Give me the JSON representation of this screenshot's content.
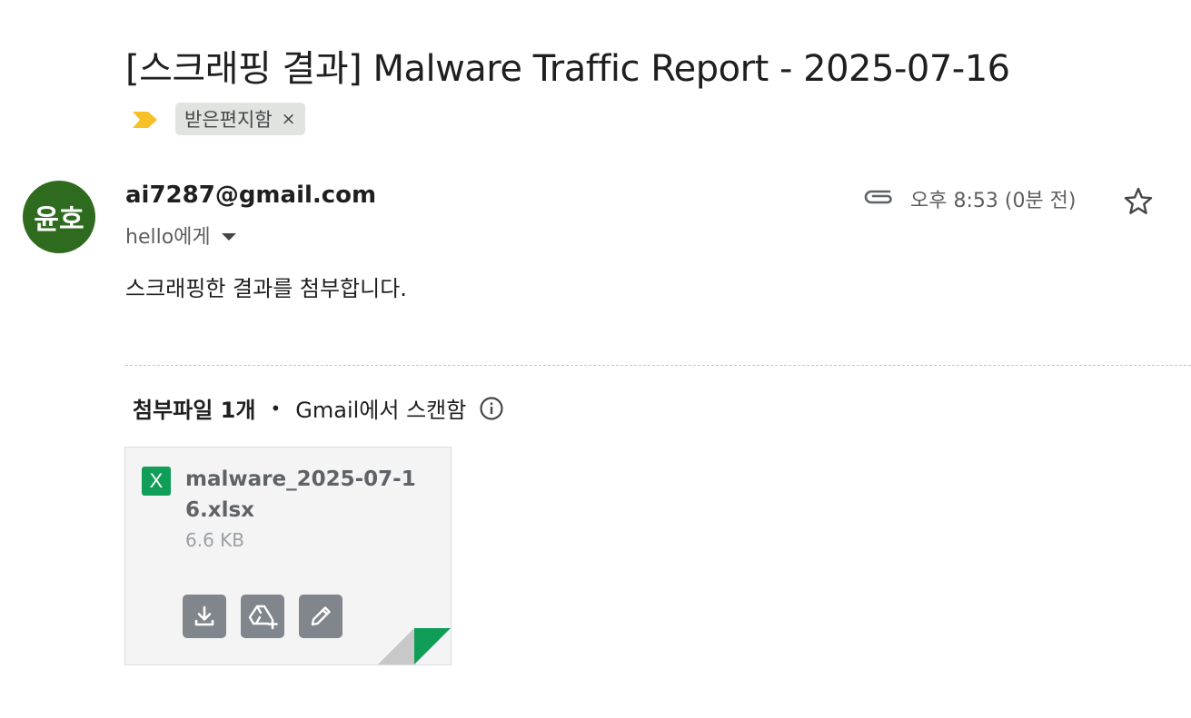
{
  "email": {
    "subject": "[스크래핑 결과] Malware Traffic Report - 2025-07-16",
    "label": "받은편지함",
    "label_remove": "×",
    "importance_icon": "importance-marker-icon",
    "sender": {
      "avatar_text": "윤호",
      "avatar_color": "#2e6b1f",
      "address": "ai7287@gmail.com",
      "recipient": "hello에게"
    },
    "time": "오후 8:53 (0분 전)",
    "body": "스크래핑한 결과를 첨부합니다.",
    "attachments": {
      "count_label": "첨부파일 1개",
      "separator": "•",
      "scan_label": "Gmail에서 스캔함",
      "items": [
        {
          "icon_letter": "X",
          "icon_color": "#0f9d58",
          "name": "malware_2025-07-16.xlsx",
          "size": "6.6 KB"
        }
      ]
    }
  }
}
